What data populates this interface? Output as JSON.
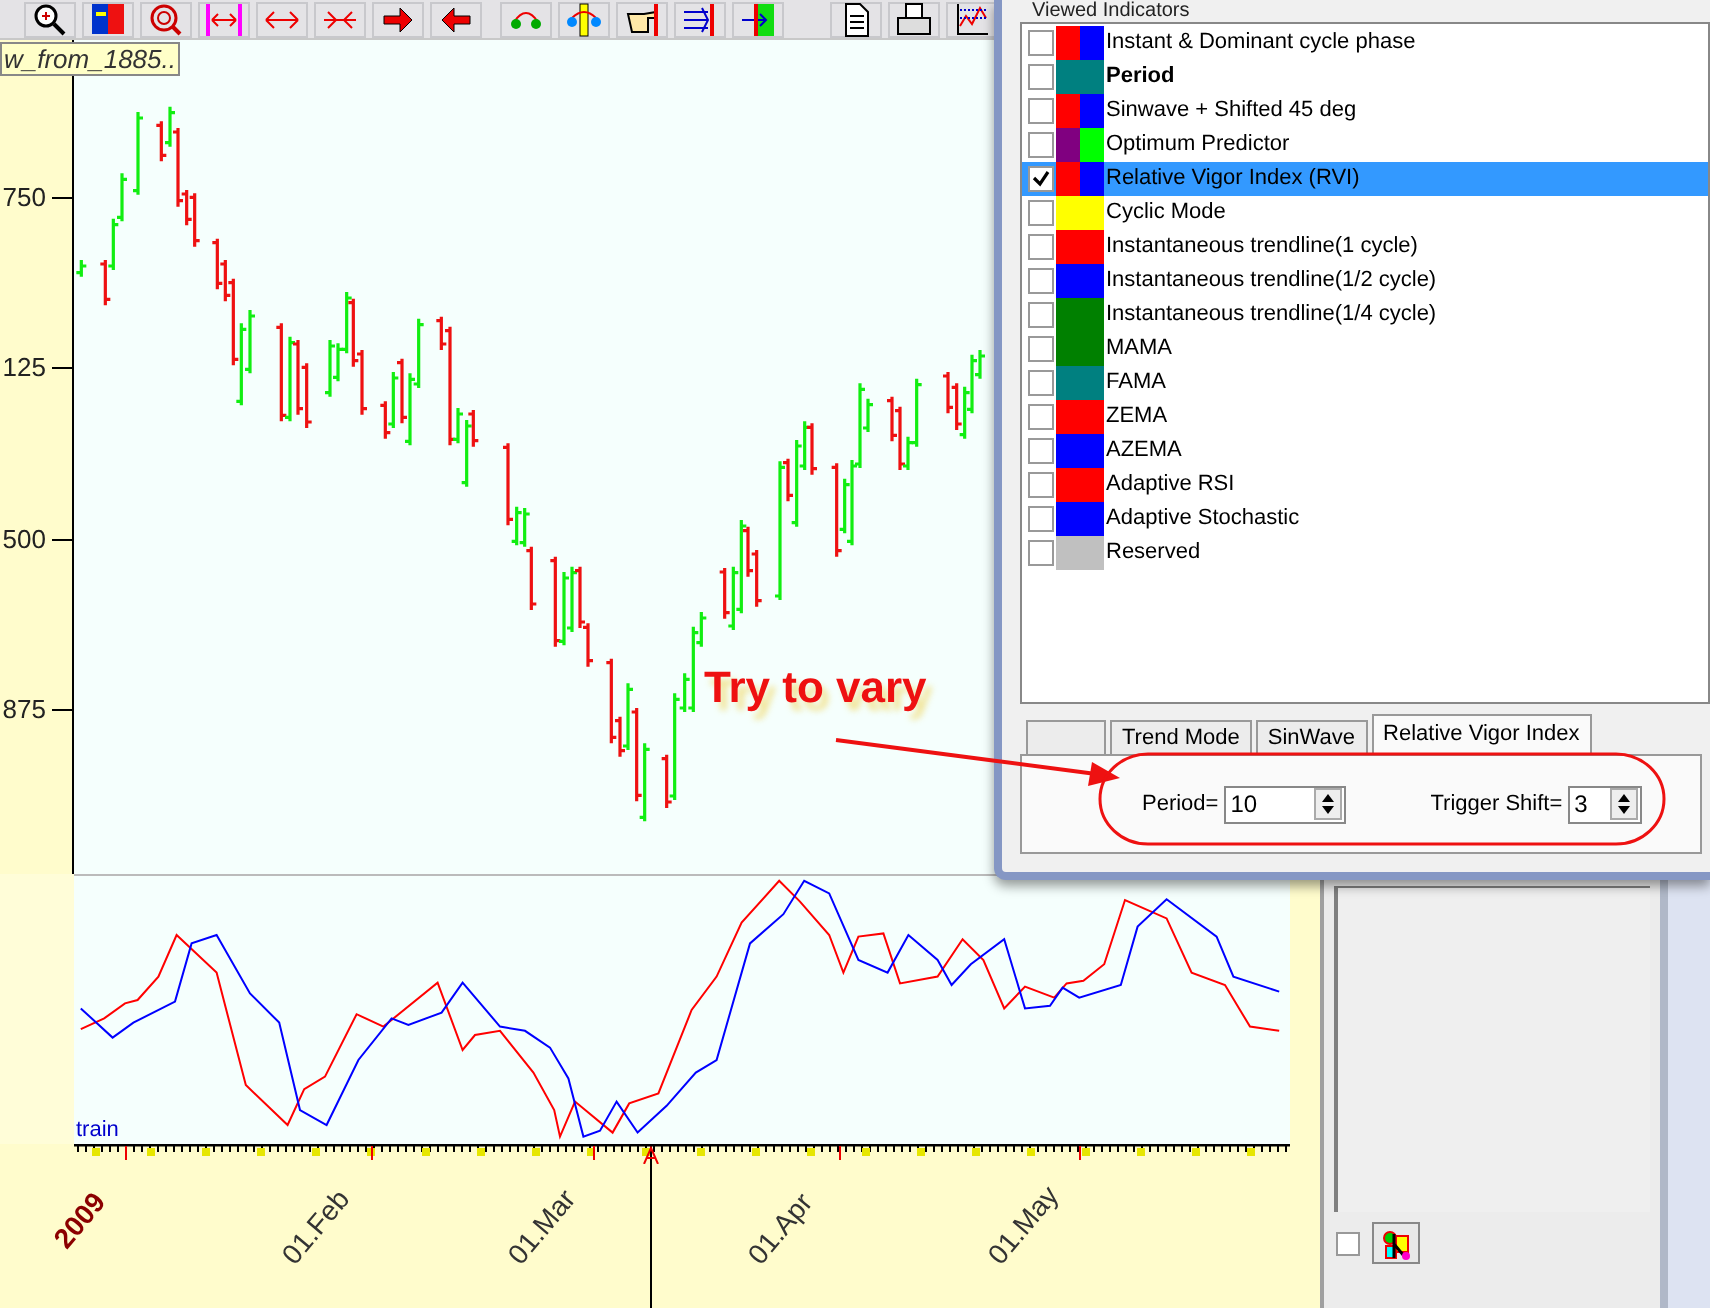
{
  "chart": {
    "series_label": "w_from_1885..",
    "price_axis_labels": [
      "750",
      "125",
      "500",
      "875"
    ],
    "oscillator_label": "train",
    "date_labels": [
      {
        "text": "2009",
        "kind": "year"
      },
      {
        "text": "01.Feb",
        "kind": "month"
      },
      {
        "text": "01.Mar",
        "kind": "month"
      },
      {
        "text": "01.Apr",
        "kind": "month"
      },
      {
        "text": "01.May",
        "kind": "month"
      }
    ]
  },
  "annotation": {
    "text": "Try to vary"
  },
  "indicators_panel": {
    "title": "Viewed Indicators",
    "items": [
      {
        "label": "Instant & Dominant cycle phase",
        "checked": false,
        "selected": false,
        "bold": false,
        "swatches": [
          {
            "color": "#ff0000"
          },
          {
            "color": "#0000ff"
          }
        ]
      },
      {
        "label": "Period",
        "checked": false,
        "selected": false,
        "bold": true,
        "swatches": [
          {
            "color": "#008080"
          }
        ]
      },
      {
        "label": "Sinwave + Shifted 45 deg",
        "checked": false,
        "selected": false,
        "bold": false,
        "swatches": [
          {
            "color": "#ff0000"
          },
          {
            "color": "#0000ff"
          }
        ]
      },
      {
        "label": "Optimum Predictor",
        "checked": false,
        "selected": false,
        "bold": false,
        "swatches": [
          {
            "color": "#800080"
          },
          {
            "color": "#00ff00"
          }
        ]
      },
      {
        "label": "Relative Vigor Index (RVI)",
        "checked": true,
        "selected": true,
        "bold": false,
        "swatches": [
          {
            "color": "#ff0000"
          },
          {
            "color": "#0000ff"
          }
        ]
      },
      {
        "label": "Cyclic Mode",
        "checked": false,
        "selected": false,
        "bold": false,
        "swatches": [
          {
            "color": "#ffff00"
          }
        ]
      },
      {
        "label": "Instantaneous trendline(1 cycle)",
        "checked": false,
        "selected": false,
        "bold": false,
        "swatches": [
          {
            "color": "#ff0000"
          }
        ]
      },
      {
        "label": "Instantaneous trendline(1/2 cycle)",
        "checked": false,
        "selected": false,
        "bold": false,
        "swatches": [
          {
            "color": "#0000ff"
          }
        ]
      },
      {
        "label": "Instantaneous trendline(1/4 cycle)",
        "checked": false,
        "selected": false,
        "bold": false,
        "swatches": [
          {
            "color": "#008000"
          }
        ]
      },
      {
        "label": "MAMA",
        "checked": false,
        "selected": false,
        "bold": false,
        "swatches": [
          {
            "color": "#008000"
          }
        ]
      },
      {
        "label": "FAMA",
        "checked": false,
        "selected": false,
        "bold": false,
        "swatches": [
          {
            "color": "#008080"
          }
        ]
      },
      {
        "label": "ZEMA",
        "checked": false,
        "selected": false,
        "bold": false,
        "swatches": [
          {
            "color": "#ff0000"
          }
        ]
      },
      {
        "label": "AZEMA",
        "checked": false,
        "selected": false,
        "bold": false,
        "swatches": [
          {
            "color": "#0000ff"
          }
        ]
      },
      {
        "label": "Adaptive RSI",
        "checked": false,
        "selected": false,
        "bold": false,
        "swatches": [
          {
            "color": "#ff0000"
          }
        ]
      },
      {
        "label": "Adaptive Stochastic",
        "checked": false,
        "selected": false,
        "bold": false,
        "swatches": [
          {
            "color": "#0000ff"
          }
        ]
      },
      {
        "label": "Reserved",
        "checked": false,
        "selected": false,
        "bold": false,
        "swatches": [
          {
            "color": "#c0c0c0"
          }
        ]
      }
    ],
    "tabs": [
      {
        "label": "Trend Mode",
        "selected": false
      },
      {
        "label": "SinWave",
        "selected": false
      },
      {
        "label": "Relative Vigor Index",
        "selected": true
      }
    ],
    "fields": [
      {
        "label": "Period=",
        "value": "10"
      },
      {
        "label": "Trigger Shift=",
        "value": "3"
      }
    ]
  },
  "side_panel": {
    "checkbox": {
      "checked": false
    }
  }
}
